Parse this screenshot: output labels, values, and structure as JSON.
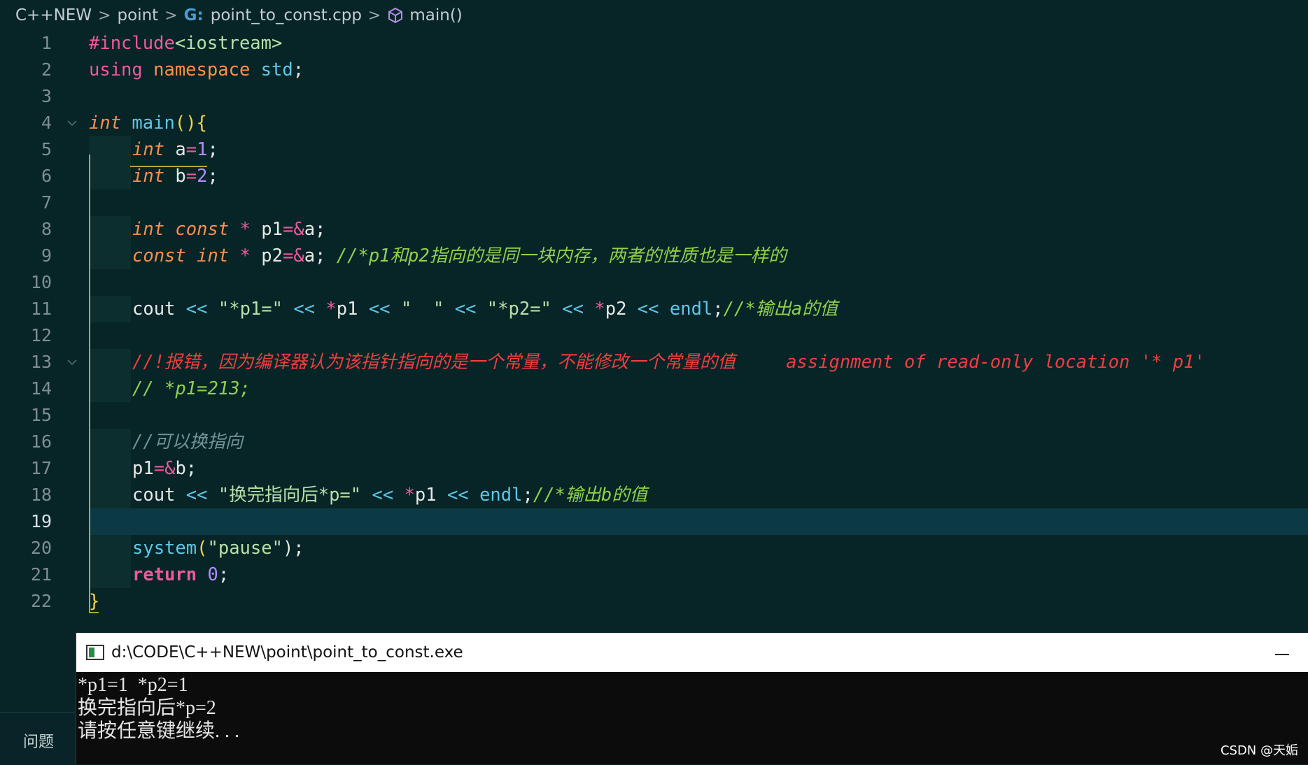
{
  "breadcrumb": {
    "items": [
      "C++NEW",
      "point",
      "point_to_const.cpp",
      "main()"
    ],
    "separator": ">"
  },
  "editor": {
    "active_line": 19,
    "line_numbers": [
      "1",
      "2",
      "3",
      "4",
      "5",
      "6",
      "7",
      "8",
      "9",
      "10",
      "11",
      "12",
      "13",
      "14",
      "15",
      "16",
      "17",
      "18",
      "19",
      "20",
      "21",
      "22"
    ],
    "lines": {
      "l1": {
        "a": "#include",
        "b": "<iostream>"
      },
      "l2": {
        "a": "using",
        "b": "namespace",
        "c": "std",
        "d": ";"
      },
      "l4": {
        "a": "int",
        "b": "main",
        "c": "()",
        "d": "{"
      },
      "l5": {
        "a": "int",
        "b": " a",
        "c": "=",
        "d": "1",
        "e": ";"
      },
      "l6": {
        "a": "int",
        "b": " b",
        "c": "=",
        "d": "2",
        "e": ";"
      },
      "l8": {
        "a": "int",
        "b": "const",
        "c": "*",
        "d": " p1",
        "e": "=&",
        "f": "a;"
      },
      "l9": {
        "a": "const",
        "b": "int",
        "c": "*",
        "d": " p2",
        "e": "=&",
        "f": "a;",
        "g": "//*p1和p2指向的是同一块内存，两者的性质也是一样的"
      },
      "l11": {
        "a": "cout",
        "b": "<<",
        "c": "\"*p1=\"",
        "d": "<<",
        "e": "*",
        "f": "p1",
        "g": "<<",
        "h": "\"  \"",
        "i": "<<",
        "j": "\"*p2=\"",
        "k": "<<",
        "l": "*",
        "m": "p2",
        "n": "<<",
        "o": "endl",
        "p": ";",
        "q": "//*输出a的值"
      },
      "l13": {
        "a": "//!报错，因为编译器认为该指针指向的是一个常量，不能修改一个常量的值",
        "b": "assignment of read-only location '* p1'"
      },
      "l14": {
        "a": "// *p1=213;"
      },
      "l16": {
        "a": "//可以换指向"
      },
      "l17": {
        "a": "p1",
        "b": "=&",
        "c": "b;"
      },
      "l18": {
        "a": "cout",
        "b": "<<",
        "c": "\"换完指向后*p=\"",
        "d": "<<",
        "e": "*",
        "f": "p1",
        "g": "<<",
        "h": "endl",
        "i": ";",
        "j": "//*输出b的值"
      },
      "l20": {
        "a": "system",
        "b": "(",
        "c": "\"pause\"",
        "d": ");"
      },
      "l21": {
        "a": "return",
        "b": "0",
        "c": ";"
      },
      "l22": {
        "a": "}"
      }
    }
  },
  "console": {
    "title": "d:\\CODE\\C++NEW\\point\\point_to_const.exe",
    "output": [
      "*p1=1  *p2=1",
      "换完指向后*p=2",
      "请按任意键继续. . ."
    ]
  },
  "panel": {
    "tab_label": "问题"
  },
  "watermark": "CSDN @天姤",
  "colors": {
    "background": "#072427",
    "keyword": "#ec5b9c",
    "type": "#ff8f4b",
    "function": "#5ec8e8",
    "string": "#b7e0a8",
    "number": "#b28cff",
    "comment": "#8fd14a",
    "error_comment": "#ef3e3e",
    "active_line": "#0c3a44"
  }
}
